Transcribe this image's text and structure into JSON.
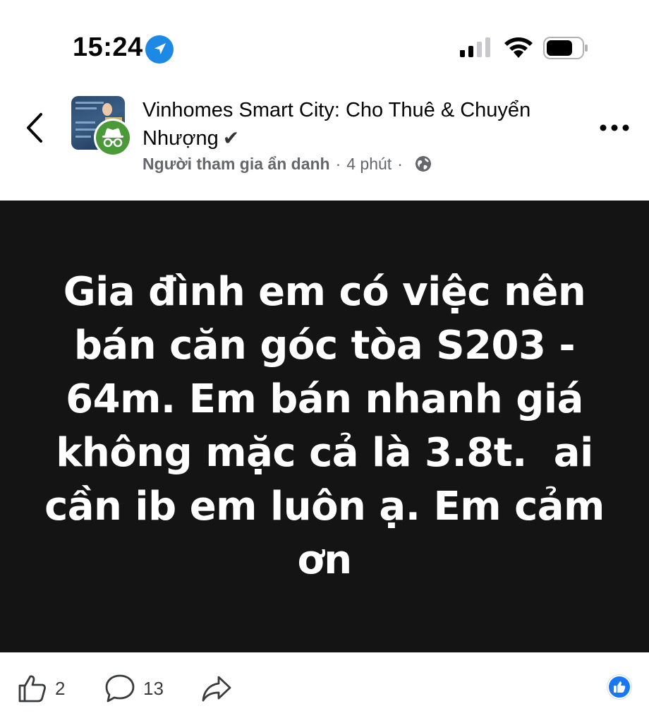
{
  "status_bar": {
    "time": "15:24",
    "icons": [
      "location-icon",
      "signal-icon",
      "wifi-icon",
      "battery-icon"
    ]
  },
  "header": {
    "group_name": "Vinhomes Smart City: Cho Thuê & Chuyển Nhượng",
    "verified_glyph": "✔",
    "author": "Người tham gia ẩn danh",
    "separator": "·",
    "time_ago": "4 phút",
    "privacy_icon": "globe-icon"
  },
  "post": {
    "text": "Gia đình em có việc nên bán căn góc tòa S203 - 64m. Em bán nhanh giá không mặc cả là 3.8t.  ai cần ib em luôn ạ. Em cảm ơn",
    "background_color": "#141414",
    "text_color": "#ffffff"
  },
  "actions": {
    "like_count": "2",
    "comment_count": "13",
    "reaction_icon": "like-reaction-icon",
    "accent_color": "#1877f2"
  }
}
